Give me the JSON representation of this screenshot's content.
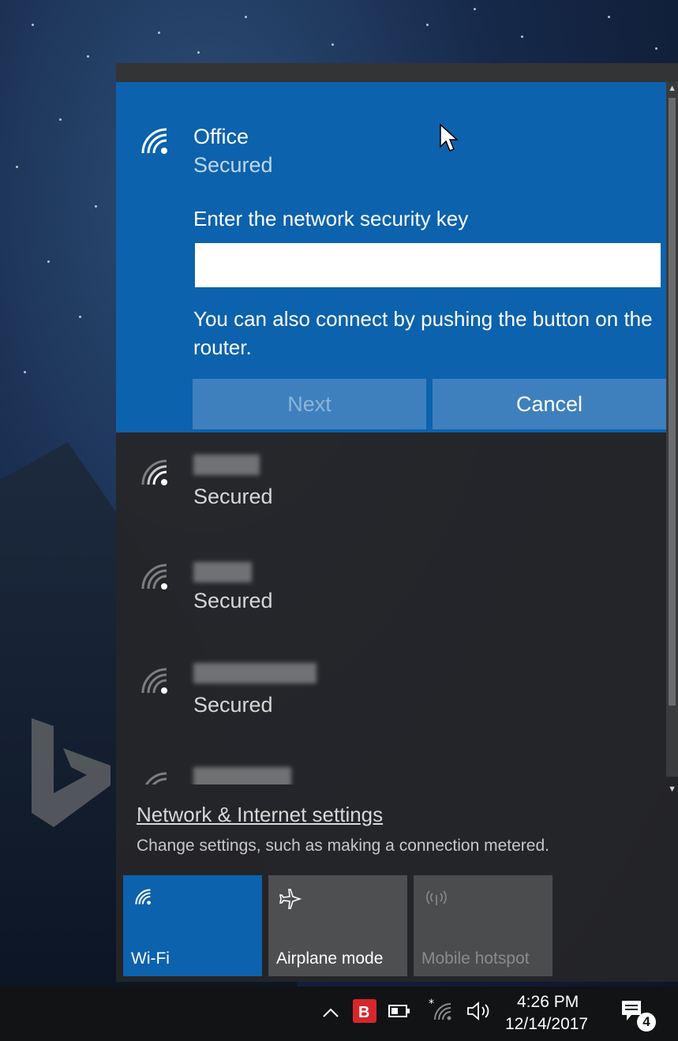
{
  "selected_network": {
    "name": "Office",
    "status": "Secured",
    "prompt": "Enter the network security key",
    "key_value": "",
    "hint": "You can also connect by pushing the button on the router.",
    "next_label": "Next",
    "cancel_label": "Cancel"
  },
  "networks": [
    {
      "name": "",
      "status": "Secured"
    },
    {
      "name": "",
      "status": "Secured"
    },
    {
      "name": "",
      "status": "Secured"
    },
    {
      "name": "",
      "status": ""
    }
  ],
  "settings": {
    "link": "Network & Internet settings",
    "description": "Change settings, such as making a connection metered."
  },
  "quick_actions": {
    "wifi": "Wi-Fi",
    "airplane": "Airplane mode",
    "hotspot": "Mobile hotspot"
  },
  "taskbar": {
    "time": "4:26 PM",
    "date": "12/14/2017",
    "notification_count": "4"
  },
  "colors": {
    "accent": "#0c62ad",
    "flyout_bg": "#262628",
    "taskbar_bg": "#121314"
  },
  "icons": {
    "network": "wifi-icon",
    "airplane": "airplane-icon",
    "hotspot": "hotspot-icon",
    "chevron_up": "chevron-up-icon",
    "battery": "battery-icon",
    "volume": "volume-icon",
    "action_center": "action-center-icon"
  }
}
